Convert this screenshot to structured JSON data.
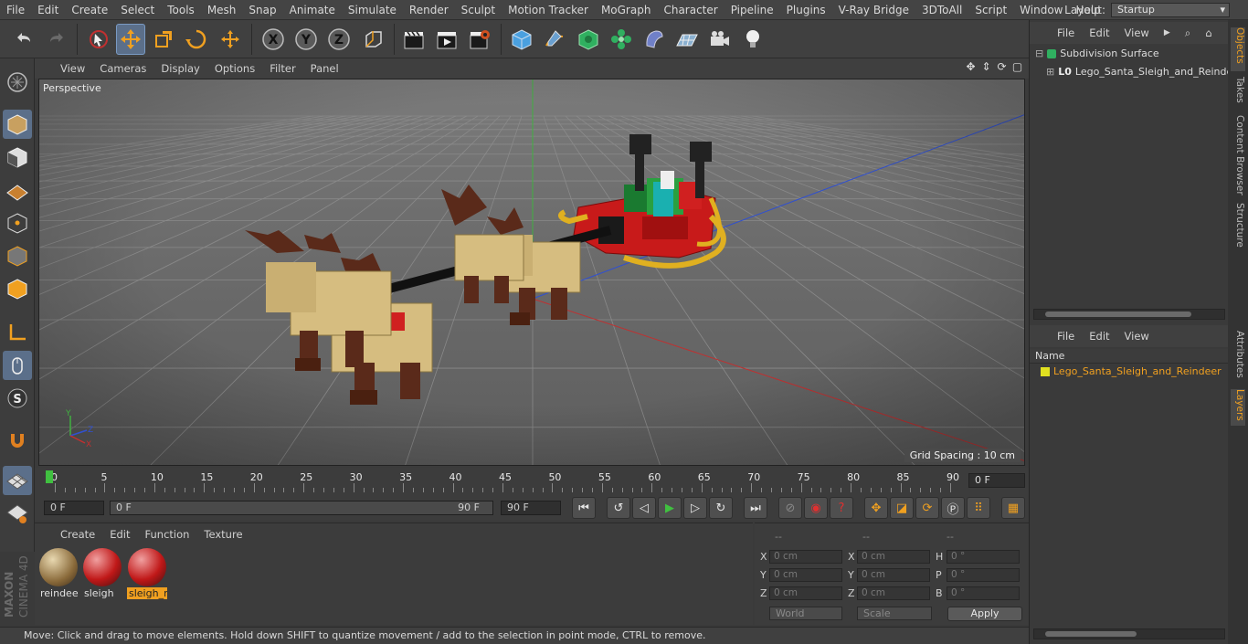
{
  "menu": [
    "File",
    "Edit",
    "Create",
    "Select",
    "Tools",
    "Mesh",
    "Snap",
    "Animate",
    "Simulate",
    "Render",
    "Sculpt",
    "Motion Tracker",
    "MoGraph",
    "Character",
    "Pipeline",
    "Plugins",
    "V-Ray Bridge",
    "3DToAll",
    "Script",
    "Window",
    "Help"
  ],
  "layout": {
    "label": "Layout:",
    "value": "Startup"
  },
  "viewport": {
    "menu": [
      "View",
      "Cameras",
      "Display",
      "Options",
      "Filter",
      "Panel"
    ],
    "label": "Perspective",
    "grid_spacing": "Grid Spacing : 10 cm"
  },
  "timeline": {
    "ticks": [
      "0",
      "5",
      "10",
      "15",
      "20",
      "25",
      "30",
      "35",
      "40",
      "45",
      "50",
      "55",
      "60",
      "65",
      "70",
      "75",
      "80",
      "85",
      "90"
    ],
    "current_frame": "0 F"
  },
  "transport": {
    "start_field": "0 F",
    "range_start": "0 F",
    "range_end": "90 F",
    "end_field": "90 F"
  },
  "materials": {
    "menu": [
      "Create",
      "Edit",
      "Function",
      "Texture"
    ],
    "items": [
      {
        "name": "reindeer",
        "selected": false
      },
      {
        "name": "sleigh",
        "selected": false
      },
      {
        "name": "sleigh_n",
        "selected": true
      }
    ]
  },
  "attributes": {
    "headers": [
      "--",
      "--",
      "--"
    ],
    "rows": [
      {
        "a": "X",
        "av": "0 cm",
        "b": "X",
        "bv": "0 cm",
        "c": "H",
        "cv": "0 °"
      },
      {
        "a": "Y",
        "av": "0 cm",
        "b": "Y",
        "bv": "0 cm",
        "c": "P",
        "cv": "0 °"
      },
      {
        "a": "Z",
        "av": "0 cm",
        "b": "Z",
        "bv": "0 cm",
        "c": "B",
        "cv": "0 °"
      }
    ],
    "coord_mode": "World",
    "scale_mode": "Scale",
    "apply": "Apply"
  },
  "status": "Move: Click and drag to move elements. Hold down SHIFT to quantize movement / add to the selection in point mode, CTRL to remove.",
  "objects": {
    "menu": [
      "File",
      "Edit",
      "View"
    ],
    "items": [
      "Subdivision Surface",
      "Lego_Santa_Sleigh_and_Reindeer"
    ]
  },
  "layers": {
    "menu": [
      "File",
      "Edit",
      "View"
    ],
    "column": "Name",
    "items": [
      "Lego_Santa_Sleigh_and_Reindeer"
    ]
  },
  "side_tabs": [
    "Objects",
    "Takes",
    "Content Browser",
    "Structure",
    "Attributes",
    "Layers"
  ],
  "brand": {
    "line1": "MAXON",
    "line2": "CINEMA 4D"
  },
  "colors": {
    "accent": "#f0a020",
    "active_tool": "#5b6f8a",
    "x_axis": "#c03030",
    "y_axis": "#40b040",
    "z_axis": "#3050d0"
  }
}
